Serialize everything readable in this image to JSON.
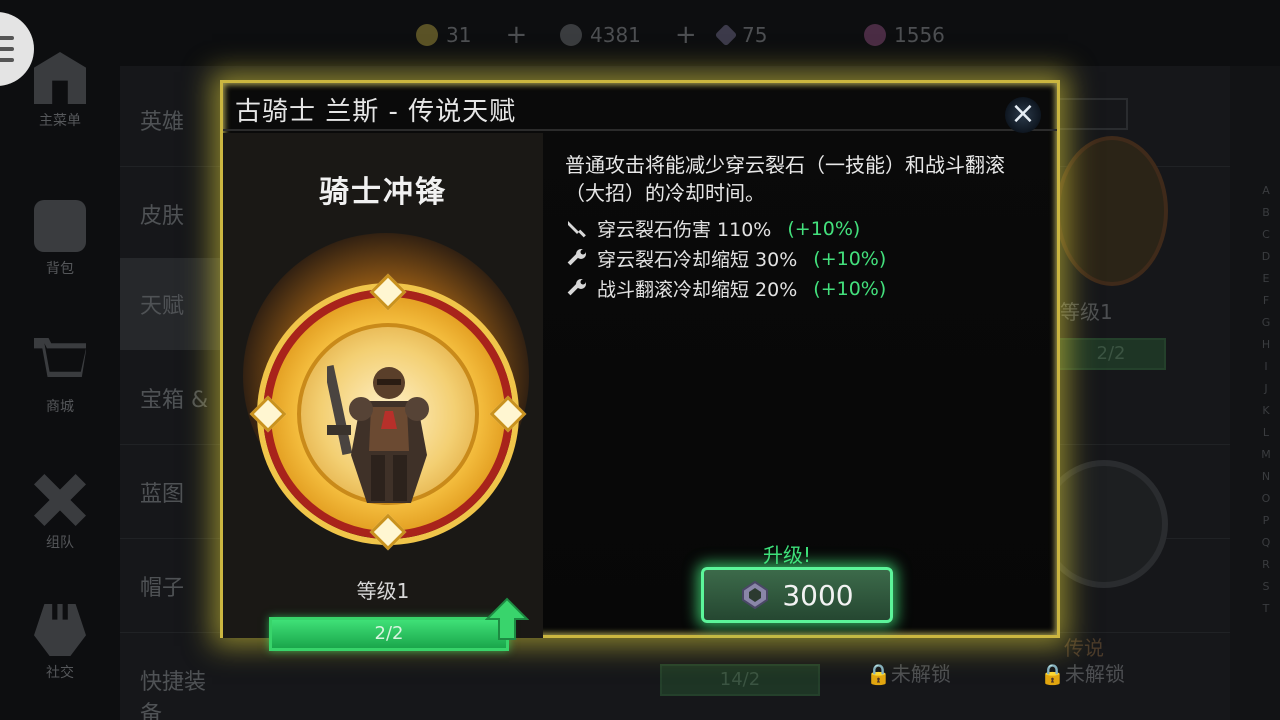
{
  "topbar": {
    "resources": [
      {
        "value": "31",
        "icon": "coin-icon",
        "has_plus": true
      },
      {
        "value": "4381",
        "icon": "gear-token-icon",
        "has_plus": true
      },
      {
        "value": "75",
        "icon": "gem-icon",
        "has_plus": false
      },
      {
        "value": "1556",
        "icon": "orb-icon",
        "has_plus": false
      }
    ]
  },
  "sidebar": {
    "items": [
      {
        "label": "主菜单",
        "icon": "castle-icon"
      },
      {
        "label": "背包",
        "icon": "backpack-icon"
      },
      {
        "label": "商城",
        "icon": "cart-icon"
      },
      {
        "label": "组队",
        "icon": "team-icon"
      },
      {
        "label": "社交",
        "icon": "social-icon"
      }
    ]
  },
  "categories": [
    "英雄",
    "皮肤",
    "天赋",
    "宝箱 &",
    "蓝图",
    "帽子",
    "快捷装备"
  ],
  "background": {
    "card_level": "等级1",
    "card_progress": "2/2",
    "bottom_progress": "14/2",
    "lock_label_1": "未解锁",
    "lock_label_2": "未解锁",
    "legend_label": "传说"
  },
  "dialog": {
    "title": "古骑士 兰斯 - 传说天赋",
    "close_symbol": "×",
    "skill_name": "骑士冲锋",
    "level": "等级1",
    "progress": {
      "current": 2,
      "max": 2,
      "label": "2/2"
    },
    "description": "普通攻击将能减少穿云裂石（一技能）和战斗翻滚（大招）的冷却时间。",
    "stats": [
      {
        "icon": "sword-icon",
        "label": "穿云裂石伤害 110%",
        "bonus": "(+10%)"
      },
      {
        "icon": "wrench-icon",
        "label": "穿云裂石冷却缩短 30%",
        "bonus": "(+10%)"
      },
      {
        "icon": "wrench-icon",
        "label": "战斗翻滚冷却缩短 20%",
        "bonus": "(+10%)"
      }
    ],
    "upgrade_label": "升级!",
    "upgrade_cost": "3000"
  },
  "colors": {
    "dialog_border": "#cbb640",
    "accent_green": "#43e07c",
    "medal_red": "#a8231b",
    "medal_gold": "#f4bd3e"
  }
}
